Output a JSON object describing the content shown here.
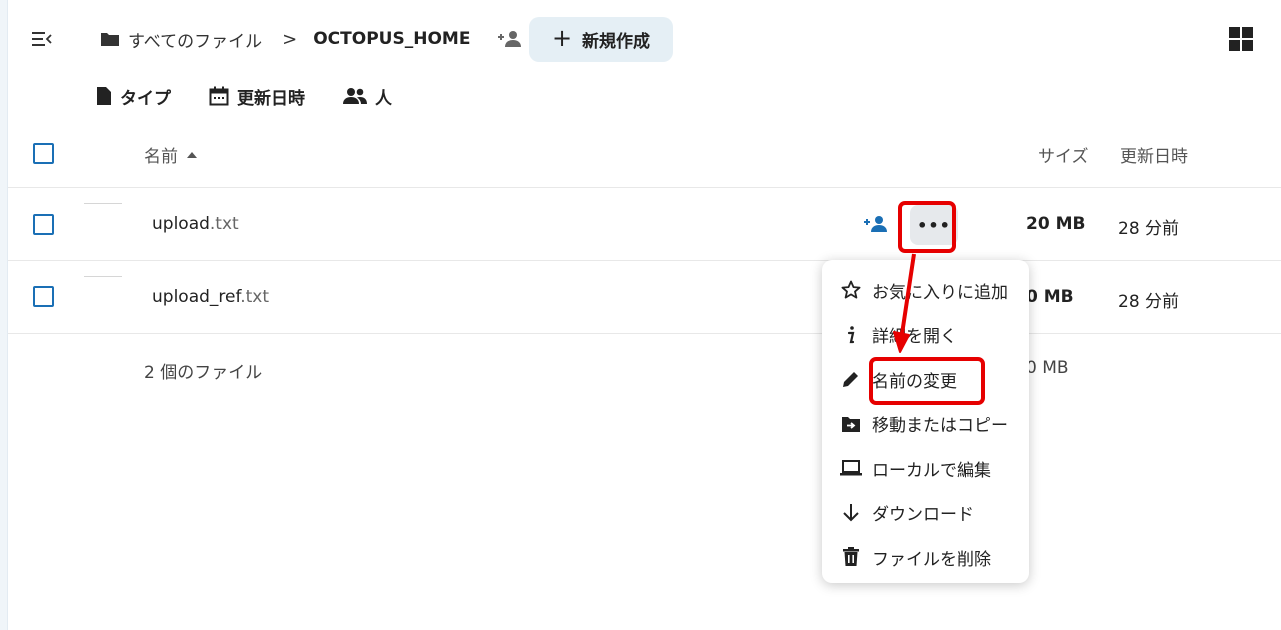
{
  "header": {
    "breadcrumb_root": "すべてのファイル",
    "breadcrumb_sep": ">",
    "breadcrumb_current": "OCTOPUS_HOME",
    "new_button_plus": "+",
    "new_button_label": "新規作成"
  },
  "filters": [
    {
      "label": "タイプ",
      "icon": "document-icon"
    },
    {
      "label": "更新日時",
      "icon": "calendar-icon"
    },
    {
      "label": "人",
      "icon": "people-icon"
    }
  ],
  "table": {
    "header": {
      "name": "名前",
      "size": "サイズ",
      "modified": "更新日時"
    },
    "rows": [
      {
        "base": "upload",
        "ext": ".txt",
        "size": "20 MB",
        "modified": "28 分前"
      },
      {
        "base": "upload_ref",
        "ext": ".txt",
        "size": "0 MB",
        "modified": "28 分前"
      }
    ],
    "more_label": "•••",
    "summary": "2 個のファイル",
    "summary_size": "0 MB"
  },
  "context_menu": [
    {
      "label": "お気に入りに追加",
      "icon": "star-icon"
    },
    {
      "label": "詳細を開く",
      "icon": "info-icon"
    },
    {
      "label": "名前の変更",
      "icon": "pencil-icon"
    },
    {
      "label": "移動またはコピー",
      "icon": "folder-move-icon"
    },
    {
      "label": "ローカルで編集",
      "icon": "laptop-icon"
    },
    {
      "label": "ダウンロード",
      "icon": "download-icon"
    },
    {
      "label": "ファイルを削除",
      "icon": "trash-icon"
    }
  ],
  "colors": {
    "accent": "#1a6fb5",
    "highlight": "#e60000",
    "new_button_bg": "#e5eff5"
  }
}
